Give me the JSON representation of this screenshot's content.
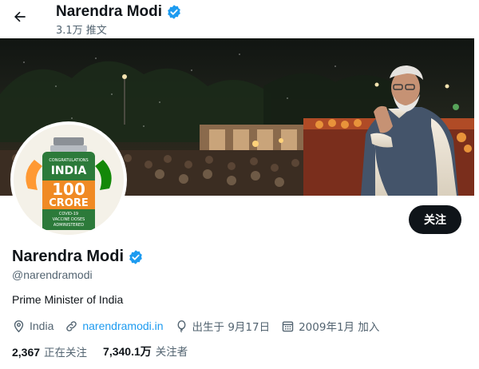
{
  "header": {
    "name": "Narendra Modi",
    "tweet_count": "3.1万 推文"
  },
  "icons": {
    "back": "arrow-left-icon",
    "verified": "verified-badge-icon",
    "location": "location-pin-icon",
    "link": "link-icon",
    "birthday": "balloon-icon",
    "joined": "calendar-icon"
  },
  "avatar": {
    "badge_small": "CONGRATULATIONS",
    "badge_country": "INDIA",
    "badge_number": "100",
    "badge_unit": "CRORE",
    "badge_line1": "COVID-19",
    "badge_line2": "VACCINE DOSES",
    "badge_line3": "ADMINISTERED"
  },
  "actions": {
    "follow_label": "关注"
  },
  "profile": {
    "name": "Narendra Modi",
    "handle": "@narendramodi",
    "bio": "Prime Minister of India",
    "location": "India",
    "website": "narendramodi.in",
    "birthday": "出生于 9月17日",
    "joined": "2009年1月 加入"
  },
  "stats": {
    "following_count": "2,367",
    "following_label": "正在关注",
    "followers_count": "7,340.1万",
    "followers_label": "关注者"
  },
  "colors": {
    "accent": "#1d9bf0",
    "text_primary": "#0f1419",
    "text_secondary": "#536471",
    "button_bg": "#0f1419",
    "saffron": "#ff9933",
    "india_green": "#138808"
  }
}
